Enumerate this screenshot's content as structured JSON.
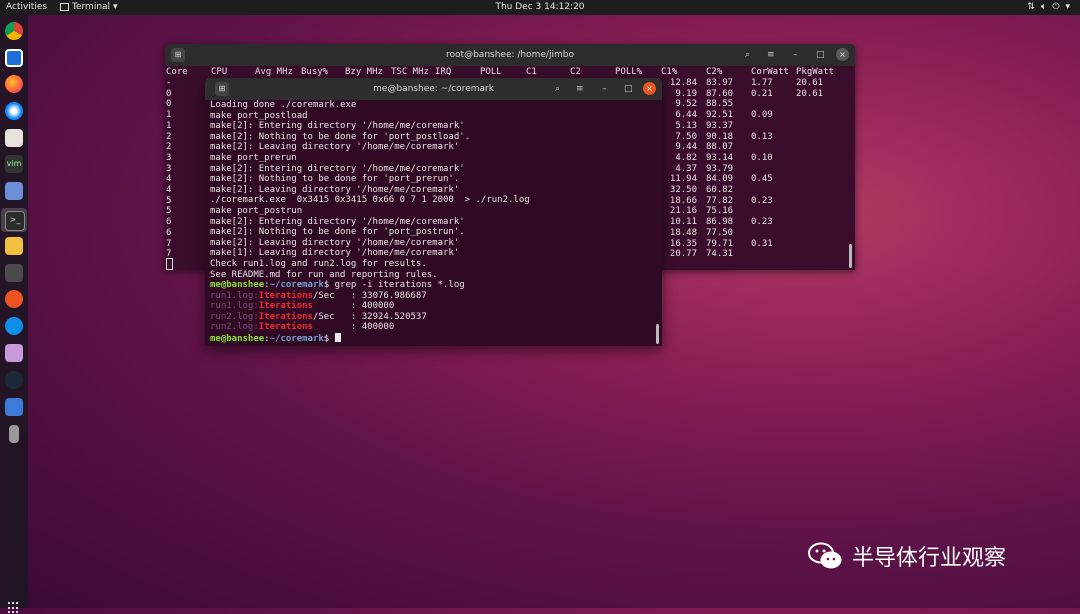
{
  "topbar": {
    "activities": "Activities",
    "app_menu": "Terminal",
    "clock": "Thu Dec 3  14:12:20"
  },
  "dock": {
    "items": [
      "chrome-icon",
      "box-icon",
      "firefox-icon",
      "thunderbird-icon",
      "files-icon",
      "vim-icon",
      "calculator-icon",
      "terminal-icon",
      "notes-icon",
      "monitor-icon",
      "ubuntu-icon",
      "teamviewer-icon",
      "remote-desktop-icon",
      "steam-icon",
      "text-editor-icon",
      "usb-drive-icon",
      "show-apps-icon"
    ]
  },
  "back_terminal": {
    "title": "root@banshee: /home/jimbo",
    "headers": [
      "Core",
      "CPU",
      "Avg_MHz",
      "Busy%",
      "Bzy_MHz",
      "TSC_MHz",
      "IRQ",
      "POLL",
      "C1",
      "C2",
      "POLL%",
      "C1%",
      "C2%",
      "CorWatt",
      "PkgWatt"
    ],
    "header_text": [
      "Core",
      "CPU",
      "Avg MHz",
      "Busy%",
      "Bzy MHz",
      "TSC MHz",
      "IRQ",
      "POLL",
      "C1",
      "C2",
      "POLL%",
      "C1%",
      "C2%",
      "CorWatt",
      "PkgWatt"
    ],
    "rows": [
      {
        "core": "-",
        "c1": "12.84",
        "c2": "83.97",
        "corwatt": "1.77",
        "pkgwatt": "20.61"
      },
      {
        "core": "0",
        "c1": "9.19",
        "c2": "87.60",
        "corwatt": "0.21",
        "pkgwatt": "20.61"
      },
      {
        "core": "0",
        "c1": "9.52",
        "c2": "88.55",
        "corwatt": "",
        "pkgwatt": ""
      },
      {
        "core": "1",
        "c1": "6.44",
        "c2": "92.51",
        "corwatt": "0.09",
        "pkgwatt": ""
      },
      {
        "core": "1",
        "c1": "5.13",
        "c2": "93.37",
        "corwatt": "",
        "pkgwatt": ""
      },
      {
        "core": "2",
        "c1": "7.50",
        "c2": "90.18",
        "corwatt": "0.13",
        "pkgwatt": ""
      },
      {
        "core": "2",
        "c1": "9.44",
        "c2": "88.07",
        "corwatt": "",
        "pkgwatt": ""
      },
      {
        "core": "3",
        "c1": "4.82",
        "c2": "93.14",
        "corwatt": "0.10",
        "pkgwatt": ""
      },
      {
        "core": "3",
        "c1": "4.37",
        "c2": "93.79",
        "corwatt": "",
        "pkgwatt": ""
      },
      {
        "core": "4",
        "c1": "11.94",
        "c2": "84.09",
        "corwatt": "0.45",
        "pkgwatt": ""
      },
      {
        "core": "4",
        "c1": "32.50",
        "c2": "60.82",
        "corwatt": "",
        "pkgwatt": ""
      },
      {
        "core": "5",
        "c1": "18.66",
        "c2": "77.82",
        "corwatt": "0.23",
        "pkgwatt": ""
      },
      {
        "core": "5",
        "c1": "21.16",
        "c2": "75.16",
        "corwatt": "",
        "pkgwatt": ""
      },
      {
        "core": "6",
        "c1": "10.11",
        "c2": "86.98",
        "corwatt": "0.23",
        "pkgwatt": ""
      },
      {
        "core": "6",
        "c1": "18.48",
        "c2": "77.50",
        "corwatt": "",
        "pkgwatt": ""
      },
      {
        "core": "7",
        "c1": "16.35",
        "c2": "79.71",
        "corwatt": "0.31",
        "pkgwatt": ""
      },
      {
        "core": "7",
        "c1": "20.77",
        "c2": "74.31",
        "corwatt": "",
        "pkgwatt": ""
      }
    ]
  },
  "front_terminal": {
    "title": "me@banshee: ~/coremark",
    "plain_lines": [
      "Loading done ./coremark.exe",
      "make port_postload",
      "make[2]: Entering directory '/home/me/coremark'",
      "make[2]: Nothing to be done for 'port_postload'.",
      "make[2]: Leaving directory '/home/me/coremark'",
      "make port_prerun",
      "make[2]: Entering directory '/home/me/coremark'",
      "make[2]: Nothing to be done for 'port_prerun'.",
      "make[2]: Leaving directory '/home/me/coremark'",
      "./coremark.exe  0x3415 0x3415 0x66 0 7 1 2000  > ./run2.log",
      "make port_postrun",
      "make[2]: Entering directory '/home/me/coremark'",
      "make[2]: Nothing to be done for 'port_postrun'.",
      "make[2]: Leaving directory '/home/me/coremark'",
      "make[1]: Leaving directory '/home/me/coremark'",
      "Check run1.log and run2.log for results.",
      "See README.md for run and reporting rules."
    ],
    "prompt_user": "me@banshee",
    "prompt_sep": ":",
    "prompt_path": "~/coremark",
    "prompt_dollar": "$",
    "command": " grep -i iterations *.log",
    "results": [
      {
        "file": "run1.log:",
        "match": "Iterations",
        "suffix": "/Sec   : 33076.986687"
      },
      {
        "file": "run1.log:",
        "match": "Iterations",
        "suffix": "       : 400000"
      },
      {
        "file": "run2.log:",
        "match": "Iterations",
        "suffix": "/Sec   : 32924.520537"
      },
      {
        "file": "run2.log:",
        "match": "Iterations",
        "suffix": "       : 400000"
      }
    ]
  },
  "watermark": {
    "text": "半导体行业观察"
  },
  "colors": {
    "terminal_bg": "#300a24",
    "prompt_user": "#8ae234",
    "prompt_path": "#729fcf",
    "grep_match": "#ef2929",
    "ubuntu_orange": "#e95420"
  }
}
